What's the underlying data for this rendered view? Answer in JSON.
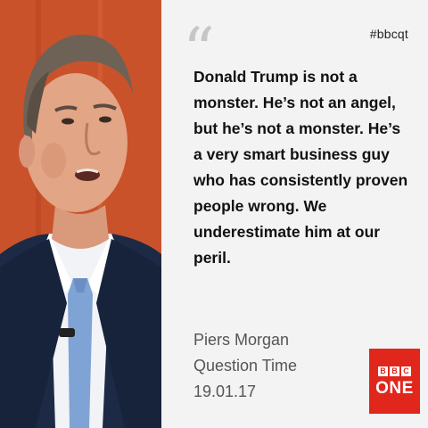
{
  "hashtag": "#bbcqt",
  "quote_mark": "“",
  "quote": "Donald Trump is not a monster. He’s not an angel, but he’s not a monster. He’s a very smart business guy who has consistently proven people wrong. We underestimate him at our peril.",
  "attribution": {
    "name": "Piers Morgan",
    "show": "Question Time",
    "date": "19.01.17"
  },
  "logo": {
    "letters": [
      "B",
      "B",
      "C"
    ],
    "word": "ONE",
    "color": "#e1261c"
  },
  "photo": {
    "background_color": "#c94e2a",
    "suit_color": "#1c2a45",
    "tie_color": "#7fa3d4"
  }
}
